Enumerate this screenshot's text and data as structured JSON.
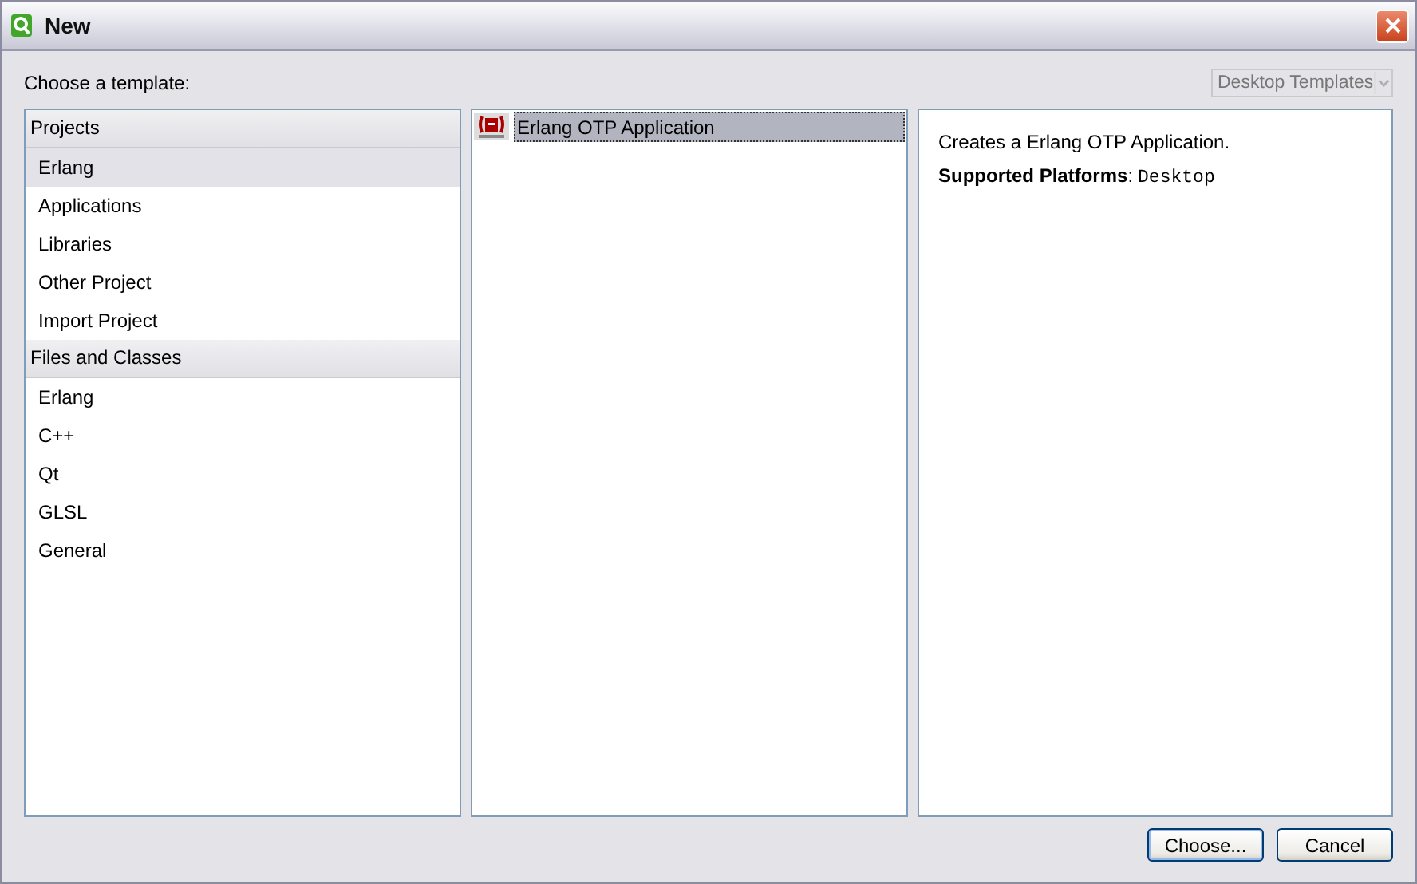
{
  "window": {
    "title": "New"
  },
  "prompt": "Choose a template:",
  "filter": {
    "value": "Desktop Templates",
    "disabled": true
  },
  "categories": [
    {
      "label": "Projects",
      "items": [
        {
          "label": "Erlang",
          "selected": true
        },
        {
          "label": "Applications",
          "selected": false
        },
        {
          "label": "Libraries",
          "selected": false
        },
        {
          "label": "Other Project",
          "selected": false
        },
        {
          "label": "Import Project",
          "selected": false
        }
      ]
    },
    {
      "label": "Files and Classes",
      "items": [
        {
          "label": "Erlang",
          "selected": false
        },
        {
          "label": "C++",
          "selected": false
        },
        {
          "label": "Qt",
          "selected": false
        },
        {
          "label": "GLSL",
          "selected": false
        },
        {
          "label": "General",
          "selected": false
        }
      ]
    }
  ],
  "templates": [
    {
      "label": "Erlang OTP Application",
      "selected": true
    }
  ],
  "description": {
    "text": "Creates a Erlang OTP Application.",
    "platforms_label": "**Supported Platforms**:",
    "platforms_value": "Desktop"
  },
  "buttons": [
    {
      "label": "Choose...",
      "default": true
    },
    {
      "label": "Cancel",
      "default": false
    }
  ]
}
